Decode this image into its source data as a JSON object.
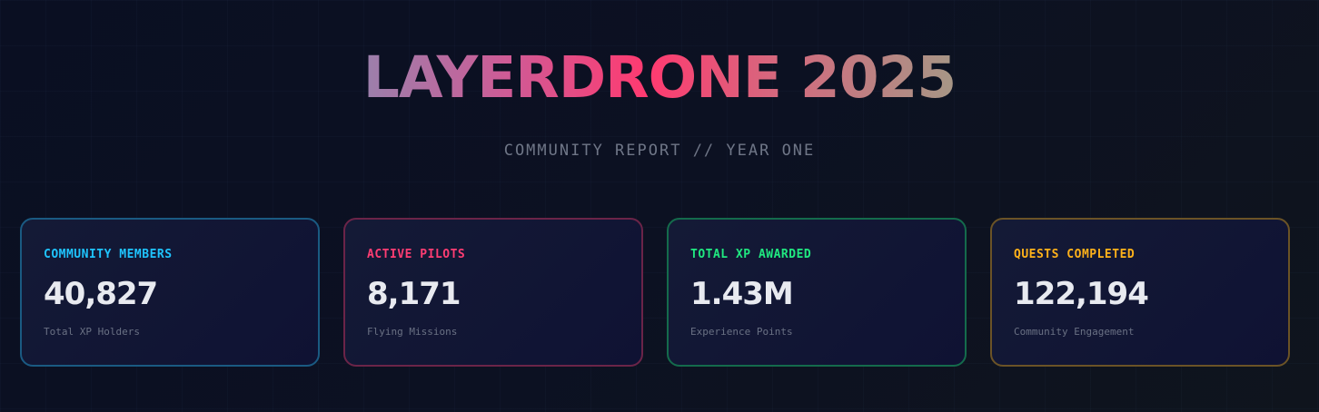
{
  "header": {
    "title": "LAYERDRONE 2025",
    "subtitle": "COMMUNITY REPORT // YEAR ONE"
  },
  "stats": [
    {
      "label": "COMMUNITY MEMBERS",
      "value": "40,827",
      "caption": "Total XP Holders",
      "accent": "#1fc4ff",
      "border": "#1a5a82"
    },
    {
      "label": "ACTIVE PILOTS",
      "value": "8,171",
      "caption": "Flying Missions",
      "accent": "#ff3d73",
      "border": "#6b2448"
    },
    {
      "label": "TOTAL XP AWARDED",
      "value": "1.43M",
      "caption": "Experience Points",
      "accent": "#20e880",
      "border": "#146b4c"
    },
    {
      "label": "QUESTS COMPLETED",
      "value": "122,194",
      "caption": "Community Engagement",
      "accent": "#ffb21a",
      "border": "#6b5326"
    }
  ]
}
